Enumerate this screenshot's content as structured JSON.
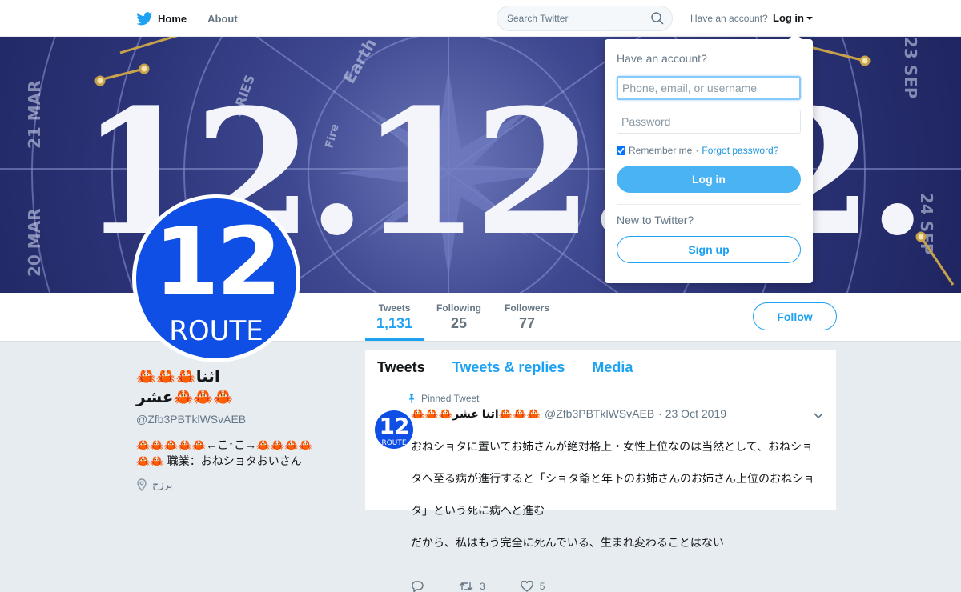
{
  "nav": {
    "home_label": "Home",
    "about_label": "About",
    "search_placeholder": "Search Twitter",
    "have_account": "Have an account?",
    "login_label": "Log in"
  },
  "banner": {
    "big_text": "12.12.12.",
    "zodiac_labels": [
      "21 MAR",
      "20 MAR",
      "24 SEP",
      "23 SEP",
      "Earth",
      "Fire",
      "ARIES"
    ]
  },
  "profile": {
    "stats": [
      {
        "label": "Tweets",
        "value": "1,131"
      },
      {
        "label": "Following",
        "value": "25"
      },
      {
        "label": "Followers",
        "value": "77"
      }
    ],
    "follow_label": "Follow",
    "avatar_number": "12",
    "avatar_word": "ROUTE",
    "display_name_line1": "🦀🦀🦀اثنا",
    "display_name_line2": "عشر🦀🦀🦀",
    "screen_name": "@Zfb3PBTklWSvAEB",
    "bio_line1": "🦀🦀🦀🦀🦀←こ↑こ→🦀🦀🦀🦀",
    "bio_line2": "🦀🦀 職業：おねショタおいさん",
    "location": "برزخ"
  },
  "timeline": {
    "tabs": [
      "Tweets",
      "Tweets & replies",
      "Media"
    ],
    "pinned_label": "Pinned Tweet",
    "tweet": {
      "display_name": "🦀🦀🦀اثنا عشر🦀🦀🦀",
      "screen_name": "@Zfb3PBTklWSvAEB",
      "date": "· 23 Oct 2019",
      "text_line1": "おねショタに置いてお姉さんが絶対格上・女性上位なのは当然として、おねショ",
      "text_line2": "タへ至る病が進行すると「ショタ爺と年下のお姉さんのお姉さん上位のおねショ",
      "text_line3": "タ」という死に病へと進む",
      "text_line4": "だから、私はもう完全に死んでいる、生まれ変わることはない",
      "retweets": "3",
      "likes": "5"
    }
  },
  "login_dropdown": {
    "title": "Have an account?",
    "username_placeholder": "Phone, email, or username",
    "password_placeholder": "Password",
    "remember_label": "Remember me",
    "separator": "·",
    "forgot_label": "Forgot password?",
    "login_button": "Log in",
    "new_label": "New to Twitter?",
    "signup_button": "Sign up"
  },
  "colors": {
    "accent": "#1da1f2",
    "avatar_blue": "#0f4fe6",
    "banner_navy": "#2c3478"
  }
}
